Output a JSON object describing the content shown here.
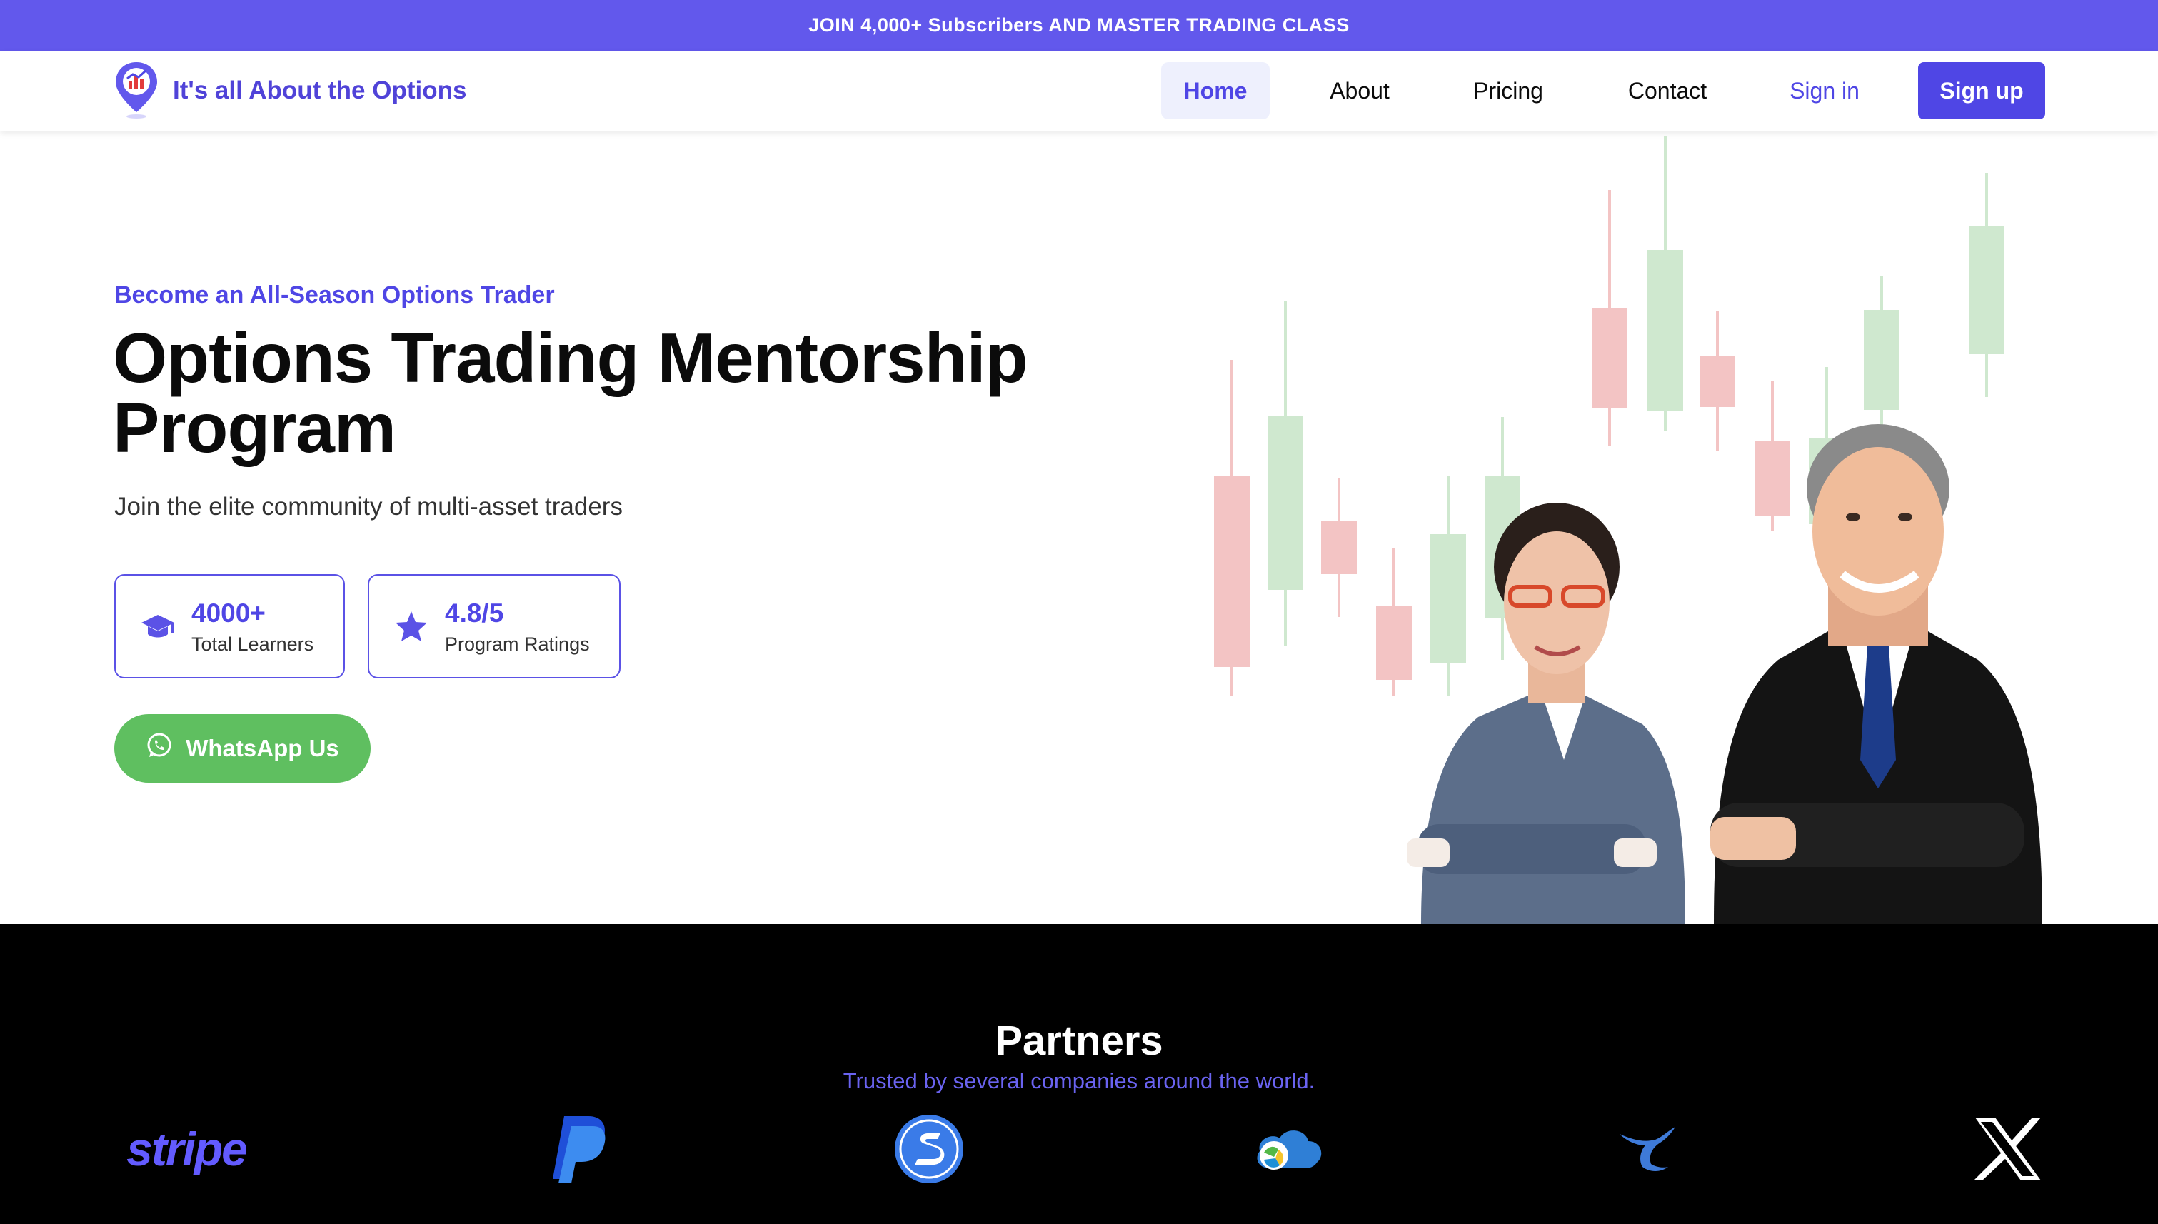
{
  "announcement": {
    "text": "JOIN 4,000+ Subscribers AND MASTER TRADING CLASS"
  },
  "brand": {
    "title": "It's all About the Options",
    "logo_icon": "map-pin-chart-icon",
    "color": "#5043d8"
  },
  "nav": {
    "home": "Home",
    "about": "About",
    "pricing": "Pricing",
    "contact": "Contact",
    "sign_in": "Sign in",
    "sign_up": "Sign up"
  },
  "hero": {
    "eyebrow": "Become an All-Season Options Trader",
    "title": "Options Trading Mentorship Program",
    "subtitle": "Join the elite community of multi-asset traders",
    "stats": [
      {
        "value": "4000+",
        "label": "Total Learners",
        "icon": "graduation-cap-icon"
      },
      {
        "value": "4.8/5",
        "label": "Program Ratings",
        "icon": "star-icon"
      }
    ],
    "cta": {
      "label": "WhatsApp Us",
      "icon": "whatsapp-icon"
    },
    "image": {
      "subject": "two-business-people-arms-crossed",
      "background": "candlestick-chart"
    }
  },
  "partners": {
    "title": "Partners",
    "subtitle": "Trusted by several companies around the world.",
    "logos": [
      {
        "name": "stripe",
        "text": "stripe"
      },
      {
        "name": "paypal-icon"
      },
      {
        "name": "skrill-icon"
      },
      {
        "name": "cloud-globe-icon"
      },
      {
        "name": "bird-icon"
      },
      {
        "name": "x-icon"
      }
    ]
  },
  "colors": {
    "accent": "#4f46e5",
    "announcement_bg": "#6258ec",
    "whatsapp_green": "#5fbf60",
    "candle_up": "#cfe8cf",
    "candle_down": "#f3c4c4",
    "footer_bg": "#000000"
  }
}
